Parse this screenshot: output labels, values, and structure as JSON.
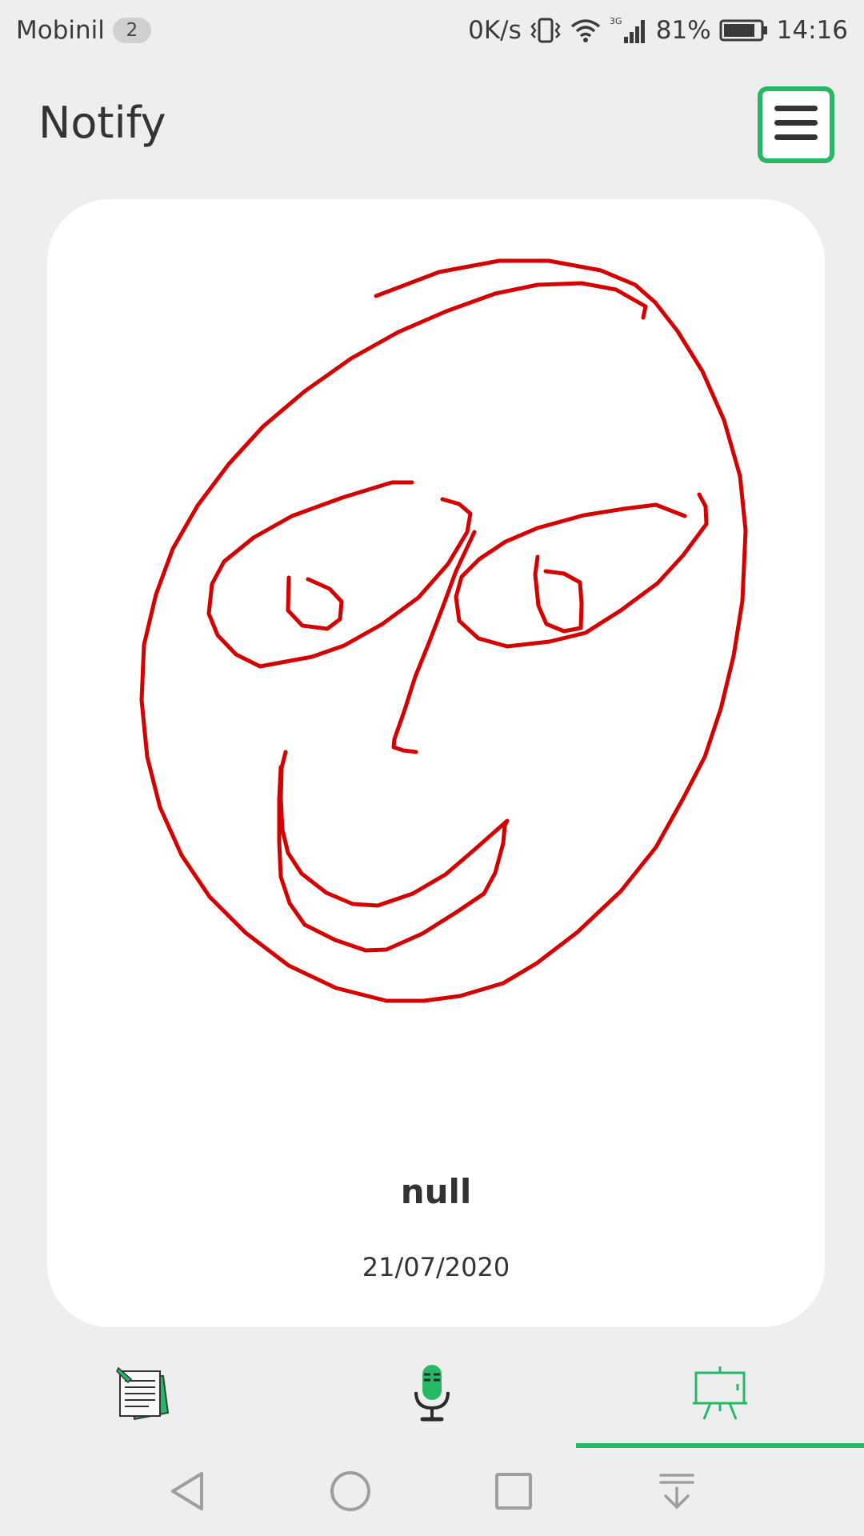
{
  "status_bar": {
    "carrier": "Mobinil",
    "carrier_badge": "2",
    "net_speed": "0K/s",
    "network_type": "3G",
    "battery": "81%",
    "time": "14:16"
  },
  "app": {
    "title": "Notify"
  },
  "note": {
    "title": "null",
    "date": "21/07/2020",
    "drawing_color": "#d40000"
  },
  "tabs": [
    {
      "name": "notes-tab",
      "icon": "notepad-icon",
      "selected": false
    },
    {
      "name": "voice-tab",
      "icon": "microphone-icon",
      "selected": false
    },
    {
      "name": "drawing-tab",
      "icon": "easel-board-icon",
      "selected": true
    }
  ],
  "colors": {
    "accent": "#27b865",
    "background": "#eeeeee",
    "card": "#ffffff"
  }
}
